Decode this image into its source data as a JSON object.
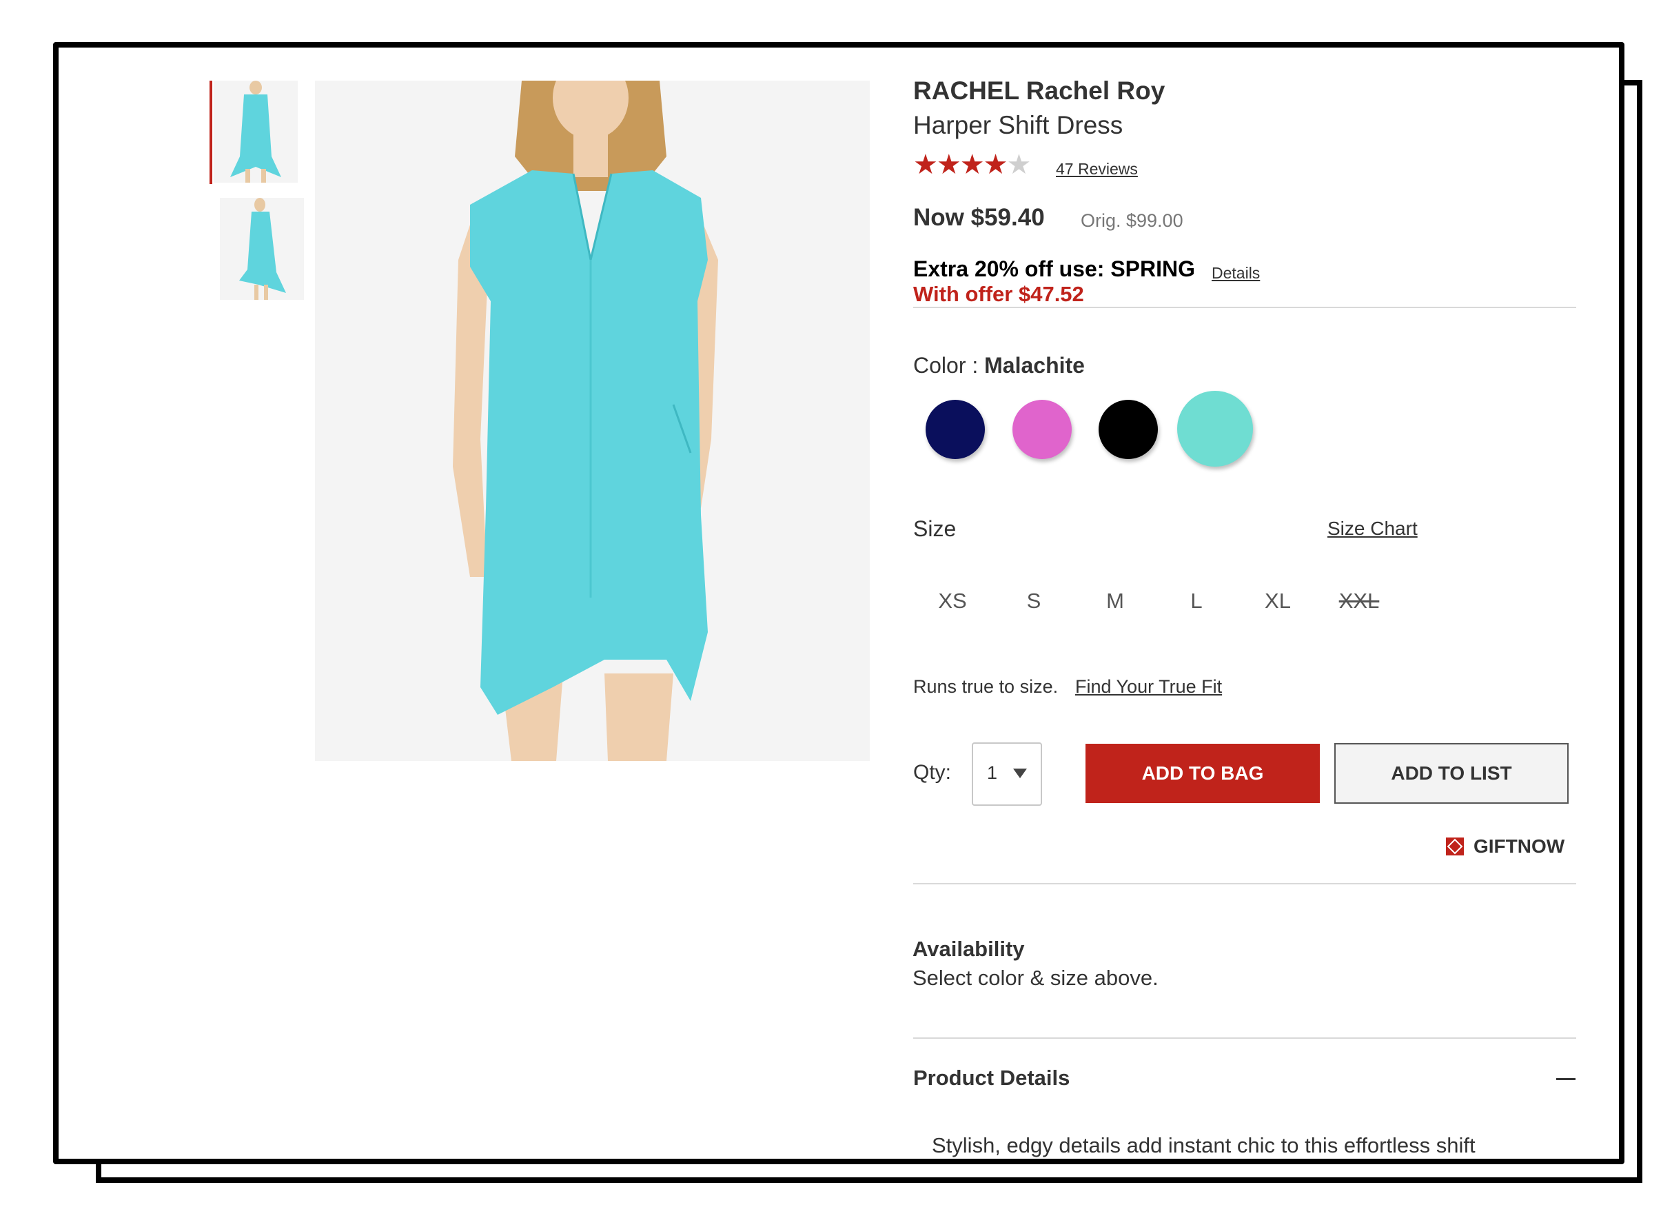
{
  "product": {
    "brand": "RACHEL Rachel Roy",
    "name": "Harper Shift Dress",
    "rating": 4,
    "rating_max": 5,
    "reviews_label": "47 Reviews"
  },
  "price": {
    "now": "Now $59.40",
    "orig": "Orig. $99.00"
  },
  "promo": {
    "text": "Extra 20% off use: SPRING",
    "details_link": "Details",
    "offer": "With offer $47.52"
  },
  "color": {
    "label": "Color : ",
    "selected": "Malachite",
    "swatches": [
      {
        "name": "Navy",
        "hex": "#0a0f5c"
      },
      {
        "name": "Pink",
        "hex": "#e064cc"
      },
      {
        "name": "Black",
        "hex": "#000000"
      },
      {
        "name": "Malachite",
        "hex": "#6fddd2"
      }
    ]
  },
  "size": {
    "label": "Size",
    "chart_link": "Size Chart",
    "options": [
      "XS",
      "S",
      "M",
      "L",
      "XL",
      "XXL"
    ],
    "unavailable": [
      "XXL"
    ]
  },
  "fit": {
    "text": "Runs true to size.",
    "link": "Find Your True Fit"
  },
  "purchase": {
    "qty_label": "Qty:",
    "qty_value": "1",
    "add_to_bag": "ADD TO BAG",
    "add_to_list": "ADD TO LIST",
    "giftnow": "GIFTNOW"
  },
  "availability": {
    "title": "Availability",
    "text": "Select color & size above."
  },
  "details": {
    "title": "Product Details",
    "description": "Stylish, edgy details add instant chic to this effortless shift"
  },
  "colors": {
    "accent_red": "#c0231b",
    "dress": "#5fd4dd"
  }
}
